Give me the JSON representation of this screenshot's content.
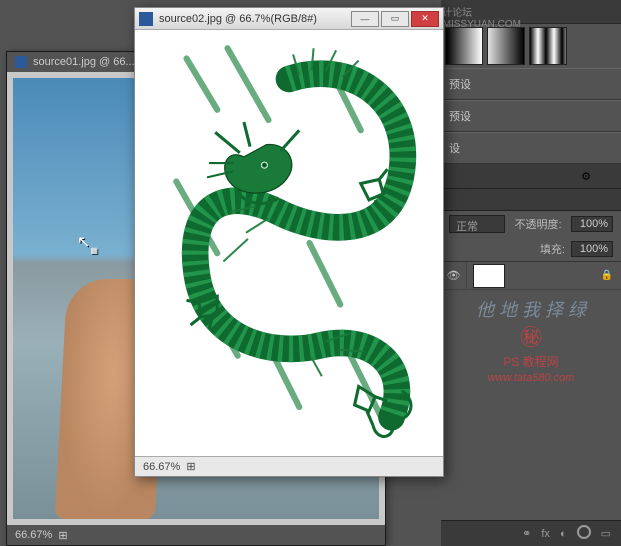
{
  "top_watermark": "思缘设计论坛 WWW.MISSYUAN.COM",
  "panels": {
    "presets": [
      "预设",
      "预设",
      "设"
    ],
    "gradients": [
      "linear-gradient(to right,#000,#fff)",
      "linear-gradient(to right,#e0e0e0,#000)",
      "linear-gradient(to right,#000,#fff 20%,#000 40%,#fff 60%,#000 80%,#fff)"
    ]
  },
  "layers": {
    "blend_mode": "正常",
    "opacity_label": "不透明度:",
    "opacity_value": "100%",
    "fill_label": "填充:",
    "fill_value": "100%"
  },
  "watermark": {
    "script": "他\n地\n我\n择\n绿",
    "label": "PS 教程网",
    "url": "www.tata580.com"
  },
  "doc_bg": {
    "tab_title": "source01.jpg @ 66...",
    "zoom": "66.67%"
  },
  "doc_fg": {
    "title": "source02.jpg @ 66.7%(RGB/8#)",
    "zoom": "66.67%"
  }
}
